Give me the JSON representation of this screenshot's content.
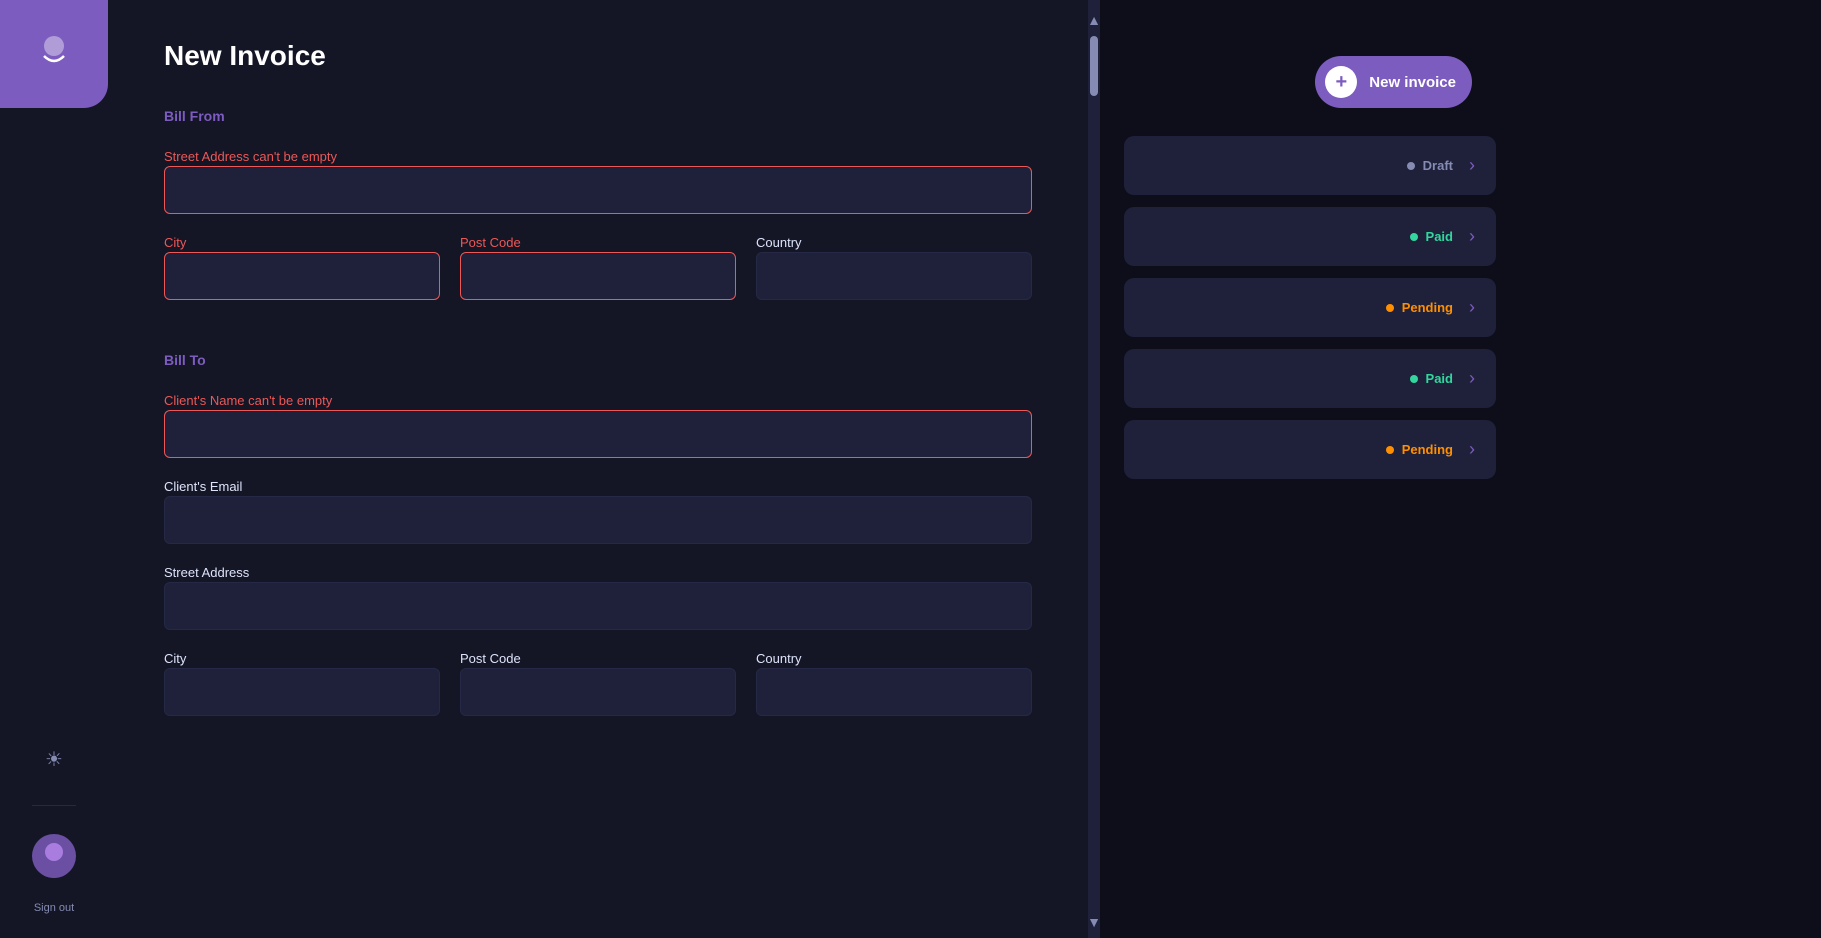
{
  "sidebar": {
    "logo_icon": "🐱",
    "theme_icon": "☀",
    "sign_out_label": "Sign out"
  },
  "page": {
    "title": "New Invoice",
    "bill_from_label": "Bill From",
    "bill_to_label": "Bill To",
    "fields": {
      "street_address_label_error": "Street Address can't be empty",
      "city_label_error": "City",
      "post_code_label_error": "Post Code",
      "country_label": "Country",
      "clients_name_label_error": "Client's Name can't be empty",
      "clients_email_label": "Client's Email",
      "street_address_to_label": "Street Address",
      "city_to_label": "City",
      "post_code_to_label": "Post Code",
      "country_to_label": "Country"
    }
  },
  "new_invoice_button": {
    "label": "New invoice",
    "plus": "+"
  },
  "invoice_list": [
    {
      "status": "Draft",
      "status_class": "draft"
    },
    {
      "status": "Paid",
      "status_class": "paid"
    },
    {
      "status": "Pending",
      "status_class": "pending"
    },
    {
      "status": "Paid",
      "status_class": "paid"
    },
    {
      "status": "Pending",
      "status_class": "pending"
    }
  ]
}
